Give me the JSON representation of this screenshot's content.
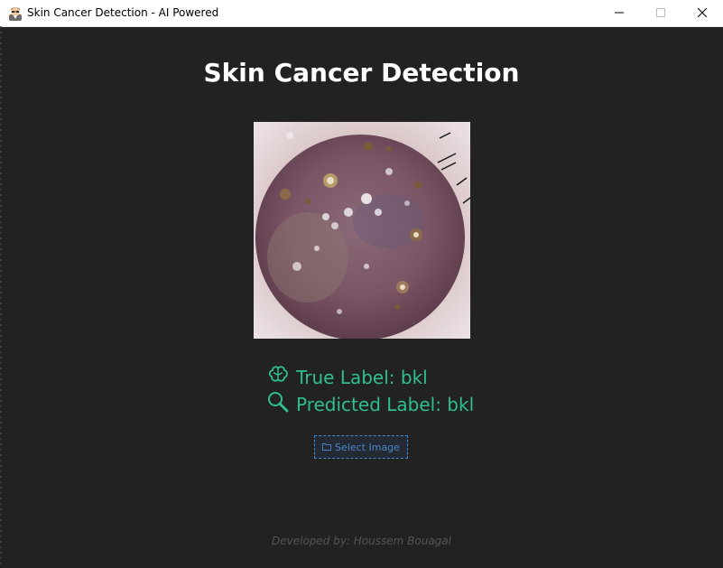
{
  "window": {
    "title": "Skin Cancer Detection - AI Powered",
    "app_icon": "doctor-icon",
    "controls": [
      "minimize-icon",
      "maximize-icon",
      "close-icon"
    ]
  },
  "main": {
    "heading": "Skin Cancer Detection",
    "image": {
      "subject": "dermoscopy lesion image"
    },
    "true_label": {
      "icon": "brain-icon",
      "text": "True Label: bkl"
    },
    "predicted_label": {
      "icon": "magnifier-icon",
      "text": "Predicted Label: bkl"
    },
    "select_button": {
      "icon": "folder-icon",
      "label": "Select Image"
    }
  },
  "footer": {
    "credit": "Developed by: Houssem Bouagal"
  },
  "colors": {
    "background": "#222222",
    "accent_green": "#2fbf8f",
    "button_blue": "#4a87c9",
    "footer_text": "#545454"
  }
}
